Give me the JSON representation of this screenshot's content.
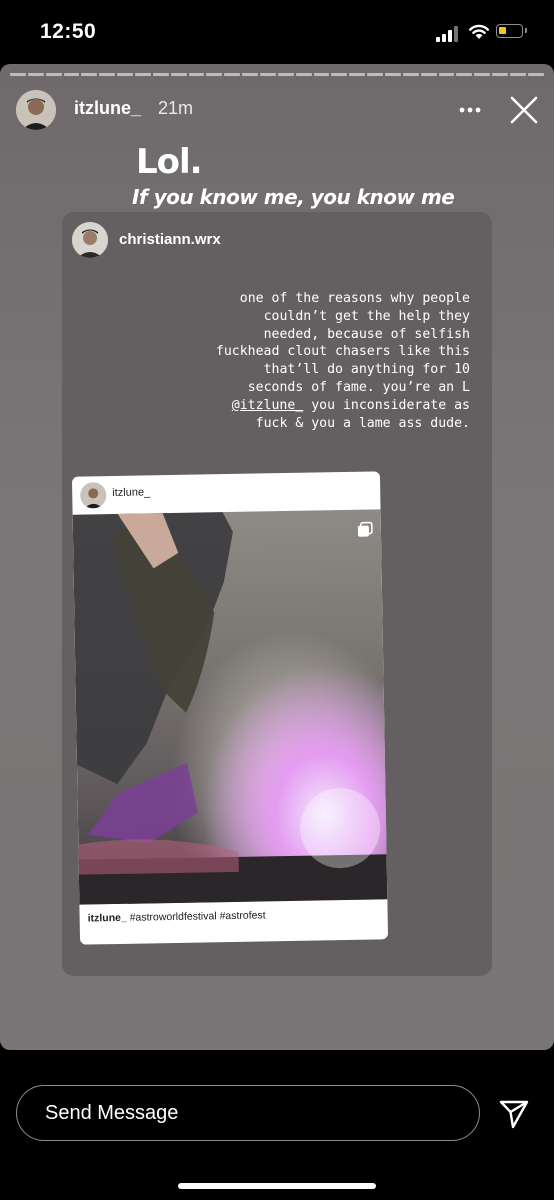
{
  "status_bar": {
    "time": "12:50",
    "battery_color": "#f5c518"
  },
  "story": {
    "username": "itzlune_",
    "time_ago": "21m",
    "caption_line1": "Lol.",
    "caption_line2": "If you know me, you know me",
    "more_icon": "more-horizontal-icon",
    "close_icon": "close-icon",
    "shared_story": {
      "username": "christiann.wrx",
      "text_before_mention": "one of the reasons why people couldn’t get the help they needed, because of selfish fuckhead clout chasers like this that’ll do anything for 10 seconds of fame. you’re an L",
      "mention": "@itzlune_",
      "text_after_mention": "you inconsiderate as fuck & you a lame ass dude.",
      "post": {
        "username": "itzlune_",
        "caption_user": "itzlune_",
        "caption_tags": "#astroworldfestival #astrofest",
        "carousel_icon": "carousel-icon"
      }
    }
  },
  "reply": {
    "placeholder": "Send Message",
    "send_icon": "send-icon"
  }
}
